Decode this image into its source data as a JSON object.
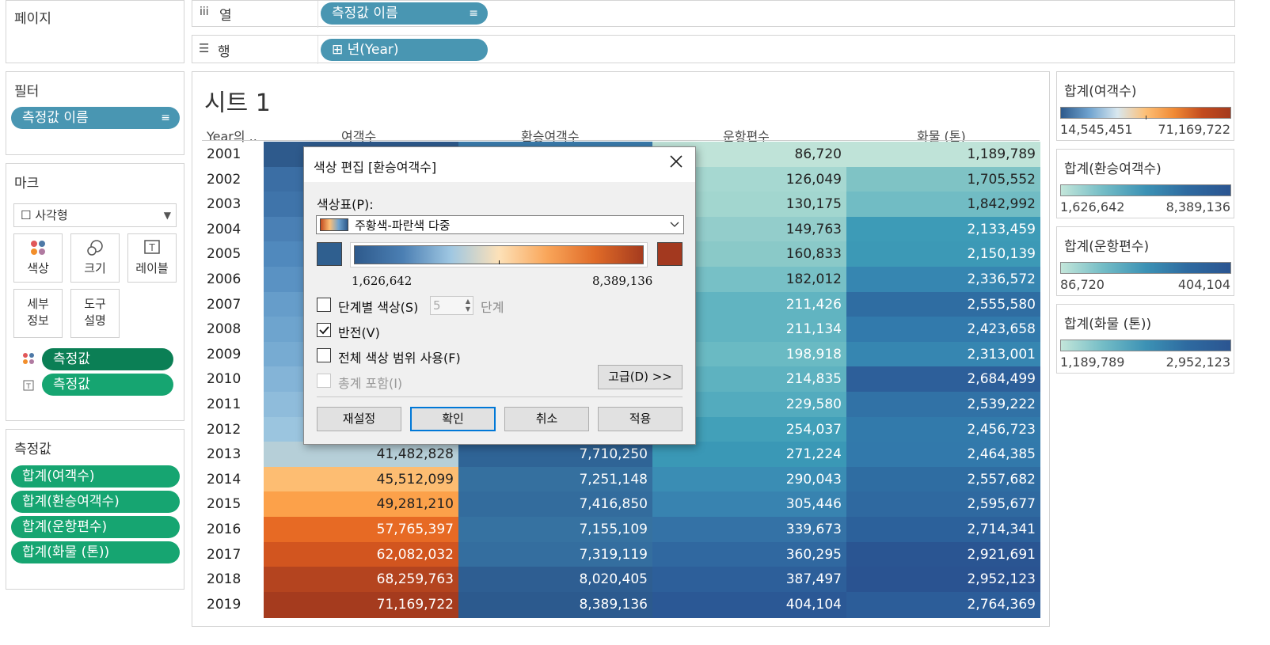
{
  "left_panel": {
    "pages_title": "페이지",
    "filters_title": "필터",
    "filter_pill": "측정값 이름",
    "marks_title": "마크",
    "mark_type": "☐ 사각형",
    "mark_buttons": [
      {
        "label": "색상",
        "icon": "color-dots-icon"
      },
      {
        "label": "크기",
        "icon": "size-circles-icon"
      },
      {
        "label": "레이블",
        "icon": "text-label-icon"
      },
      {
        "label": "세부\n정보",
        "icon": "detail-icon"
      },
      {
        "label": "도구\n설명",
        "icon": "tooltip-icon"
      }
    ],
    "mark_pills": [
      "측정값",
      "측정값"
    ],
    "measures_title": "측정값",
    "measure_pills": [
      "합계(여객수)",
      "합계(환승여객수)",
      "합계(운항편수)",
      "합계(화물 (톤))"
    ]
  },
  "shelves": {
    "columns_label": "열",
    "columns_pill": "측정값 이름",
    "rows_label": "행",
    "rows_pill": "⊞ 년(Year)"
  },
  "sheet": {
    "title": "시트 1",
    "headers": [
      "Year의 ..",
      "여객수",
      "환승여객수",
      "운항편수",
      "화물 (톤)"
    ],
    "rows": [
      {
        "year": "2001",
        "p": "",
        "t": "",
        "f": "86,720",
        "c": "1,189,789"
      },
      {
        "year": "2002",
        "p": "",
        "t": "",
        "f": "126,049",
        "c": "1,705,552"
      },
      {
        "year": "2003",
        "p": "",
        "t": "",
        "f": "130,175",
        "c": "1,842,992"
      },
      {
        "year": "2004",
        "p": "",
        "t": "",
        "f": "149,763",
        "c": "2,133,459"
      },
      {
        "year": "2005",
        "p": "",
        "t": "",
        "f": "160,833",
        "c": "2,150,139"
      },
      {
        "year": "2006",
        "p": "",
        "t": "",
        "f": "182,012",
        "c": "2,336,572"
      },
      {
        "year": "2007",
        "p": "",
        "t": "",
        "f": "211,426",
        "c": "2,555,580"
      },
      {
        "year": "2008",
        "p": "",
        "t": "",
        "f": "211,134",
        "c": "2,423,658"
      },
      {
        "year": "2009",
        "p": "",
        "t": "",
        "f": "198,918",
        "c": "2,313,001"
      },
      {
        "year": "2010",
        "p": "",
        "t": "",
        "f": "214,835",
        "c": "2,684,499"
      },
      {
        "year": "2011",
        "p": "",
        "t": "",
        "f": "229,580",
        "c": "2,539,222"
      },
      {
        "year": "2012",
        "p": "",
        "t": "",
        "f": "254,037",
        "c": "2,456,723"
      },
      {
        "year": "2013",
        "p": "41,482,828",
        "t": "7,710,250",
        "f": "271,224",
        "c": "2,464,385"
      },
      {
        "year": "2014",
        "p": "45,512,099",
        "t": "7,251,148",
        "f": "290,043",
        "c": "2,557,682"
      },
      {
        "year": "2015",
        "p": "49,281,210",
        "t": "7,416,850",
        "f": "305,446",
        "c": "2,595,677"
      },
      {
        "year": "2016",
        "p": "57,765,397",
        "t": "7,155,109",
        "f": "339,673",
        "c": "2,714,341"
      },
      {
        "year": "2017",
        "p": "62,082,032",
        "t": "7,319,119",
        "f": "360,295",
        "c": "2,921,691"
      },
      {
        "year": "2018",
        "p": "68,259,763",
        "t": "8,020,405",
        "f": "387,497",
        "c": "2,952,123"
      },
      {
        "year": "2019",
        "p": "71,169,722",
        "t": "8,389,136",
        "f": "404,104",
        "c": "2,764,369"
      }
    ],
    "passenger_colors": [
      "#2e5a8c",
      "#3b6ea4",
      "#3f74aa",
      "#4a80b5",
      "#5089bd",
      "#5a92c3",
      "#669dca",
      "#6ea4ce",
      "#77abd2",
      "#84b4d7",
      "#8fbcdb",
      "#9bc5df",
      "#b6cfd8",
      "#fdbd72",
      "#fca14a",
      "#e76a24",
      "#d2551f",
      "#b4441f",
      "#a53b1e"
    ],
    "transfer_colors": [
      "#3a7bab",
      "#3f81b0",
      "#3b7aa9",
      "#3b7aa9",
      "#3a7aa9",
      "#3a7aa9",
      "#3a7aa9",
      "#3a7aa9",
      "#3a7aa9",
      "#3a7aa9",
      "#3a7aa9",
      "#3a7aa9",
      "#2f6496",
      "#35709f",
      "#336c9d",
      "#3672a1",
      "#346e9f",
      "#2e5e92",
      "#2c5a8e"
    ],
    "flight_colors": [
      "#bfe3d8",
      "#a6d8d1",
      "#a2d6cf",
      "#93cdcb",
      "#8ac9c8",
      "#77c0c6",
      "#61b4c1",
      "#61b4c1",
      "#6abac3",
      "#5eb2c0",
      "#53abbe",
      "#42a0b9",
      "#3a98b6",
      "#3a8db4",
      "#3883b0",
      "#3472a6",
      "#3068a0",
      "#2d5f9a",
      "#2b5895"
    ],
    "cargo_colors": [
      "#bfe3d8",
      "#7fc3c5",
      "#71bcc4",
      "#3d9bb7",
      "#3c99b6",
      "#3686b1",
      "#2f6da2",
      "#327aac",
      "#3686b1",
      "#2d5f9a",
      "#3172a6",
      "#327aab",
      "#3279ab",
      "#2f6da2",
      "#2f69a0",
      "#2c619b",
      "#2a5592",
      "#2a5391",
      "#2c5d99"
    ]
  },
  "legends": [
    {
      "title": "합계(여객수)",
      "min": "14,545,451",
      "max": "71,169,722",
      "gradient": "linear-gradient(90deg,#2e5a8c,#6fa3cf,#d8e7ef,#fdbf76,#f08a35,#c34b1e,#a53b1e)"
    },
    {
      "title": "합계(환승여객수)",
      "min": "1,626,642",
      "max": "8,389,136",
      "gradient": "linear-gradient(90deg,#c3e6da,#73bcc6,#3c92b5,#2e6aa0,#2b5591)"
    },
    {
      "title": "합계(운항편수)",
      "min": "86,720",
      "max": "404,104",
      "gradient": "linear-gradient(90deg,#c3e6da,#73bcc6,#3c92b5,#2e6aa0,#2b5591)"
    },
    {
      "title": "합계(화물 (톤))",
      "min": "1,189,789",
      "max": "2,952,123",
      "gradient": "linear-gradient(90deg,#c3e6da,#73bcc6,#3c92b5,#2e6aa0,#2b5591)"
    }
  ],
  "dialog": {
    "title": "색상 편집 [환승여객수]",
    "palette_label": "색상표(P):",
    "palette_value": "주황색-파란색 다중",
    "range_min": "1,626,642",
    "range_max": "8,389,136",
    "stepped_label": "단계별 색상(S)",
    "steps_value": "5",
    "steps_unit": "단계",
    "reverse_label": "반전(V)",
    "reverse_checked": true,
    "full_range_label": "전체 색상 범위 사용(F)",
    "include_totals_label": "총계 포함(I)",
    "advanced_label": "고급(D) >>",
    "buttons": [
      "재설정",
      "확인",
      "취소",
      "적용"
    ],
    "colors": {
      "start": "#2f5f8f",
      "end": "#a3391f"
    }
  }
}
